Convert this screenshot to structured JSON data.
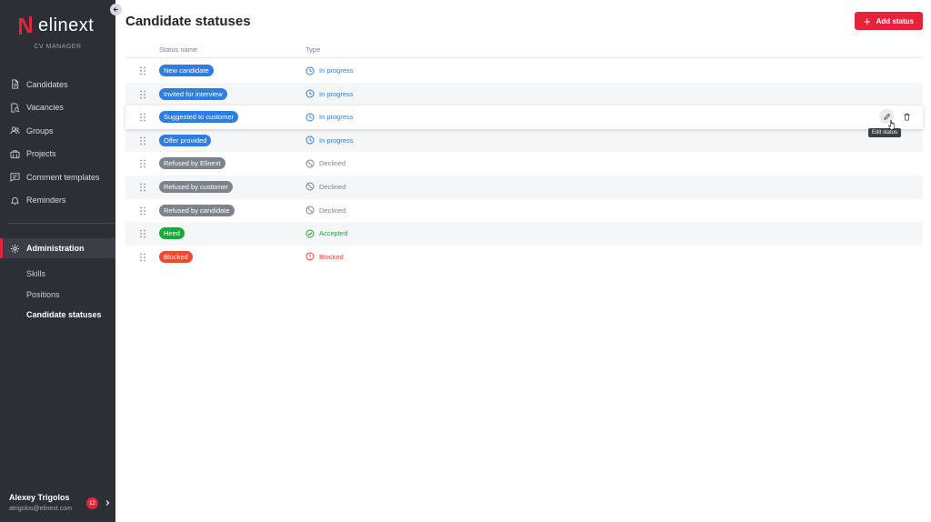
{
  "app": {
    "logo_text": "elinext",
    "subtitle": "CV MANAGER"
  },
  "colors": {
    "sidebar_bg": "#2b2f36",
    "accent": "#e5243b",
    "in_progress": "#2f7de1",
    "declined": "#7d838b",
    "accepted": "#1aaa3b",
    "blocked": "#ef4a2f"
  },
  "sidebar": {
    "items": [
      {
        "label": "Candidates",
        "icon": "document-icon"
      },
      {
        "label": "Vacancies",
        "icon": "search-doc-icon"
      },
      {
        "label": "Groups",
        "icon": "users-icon"
      },
      {
        "label": "Projects",
        "icon": "briefcase-icon"
      },
      {
        "label": "Comment templates",
        "icon": "comment-icon"
      },
      {
        "label": "Reminders",
        "icon": "bell-icon"
      }
    ],
    "admin_label": "Administration",
    "subitems": [
      "Skills",
      "Positions",
      "Candidate statuses"
    ]
  },
  "user": {
    "name": "Alexey Trigolos",
    "email": "atrigolos@elinext.com",
    "notifications": "12"
  },
  "page": {
    "title": "Candidate statuses",
    "add_button": "Add status"
  },
  "table": {
    "headers": {
      "name": "Status name",
      "type": "Type"
    },
    "rows": [
      {
        "name": "New candidate",
        "chip_color": "#2f7de1",
        "type": "In progress",
        "type_kind": "in_progress"
      },
      {
        "name": "Invited for interview",
        "chip_color": "#2f7de1",
        "type": "In progress",
        "type_kind": "in_progress"
      },
      {
        "name": "Suggested to customer",
        "chip_color": "#2f7de1",
        "type": "In progress",
        "type_kind": "in_progress"
      },
      {
        "name": "Offer provided",
        "chip_color": "#2f7de1",
        "type": "In progress",
        "type_kind": "in_progress"
      },
      {
        "name": "Refused by Elinext",
        "chip_color": "#7d838b",
        "type": "Declined",
        "type_kind": "declined"
      },
      {
        "name": "Refused by customer",
        "chip_color": "#7d838b",
        "type": "Declined",
        "type_kind": "declined"
      },
      {
        "name": "Refused by candidate",
        "chip_color": "#7d838b",
        "type": "Declined",
        "type_kind": "declined"
      },
      {
        "name": "Hired",
        "chip_color": "#1aaa3b",
        "type": "Accepted",
        "type_kind": "accepted"
      },
      {
        "name": "Blocked",
        "chip_color": "#ef4a2f",
        "type": "Blocked",
        "type_kind": "blocked"
      }
    ],
    "tooltip": "Edit status"
  }
}
